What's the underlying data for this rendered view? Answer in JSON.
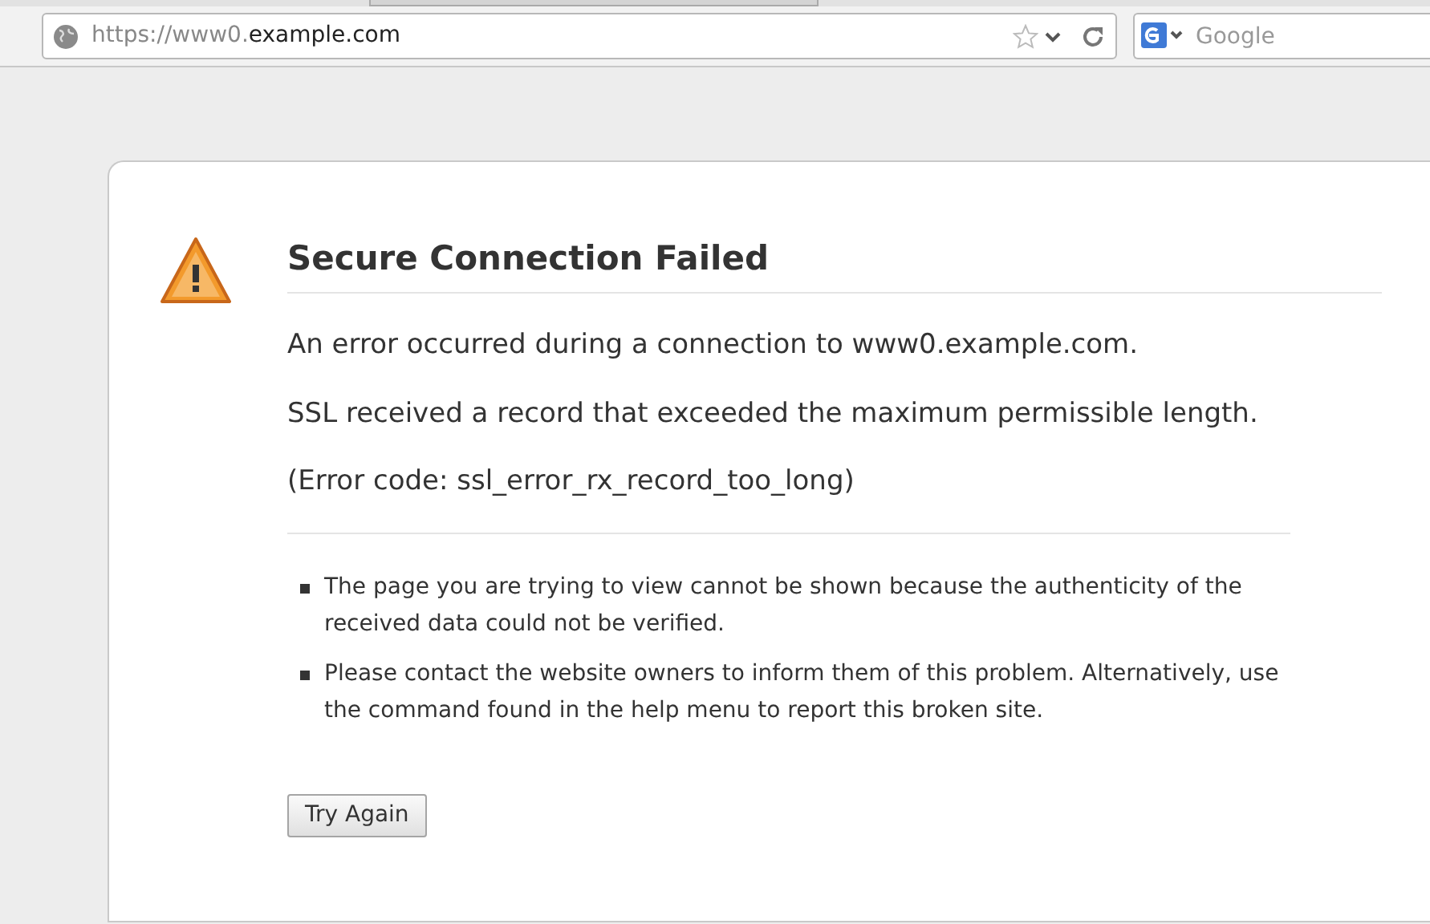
{
  "toolbar": {
    "url_prefix": "https://www0.",
    "url_domain": "example.com",
    "search": {
      "placeholder": "Google"
    }
  },
  "error": {
    "title": "Secure Connection Failed",
    "messages": [
      "An error occurred during a connection to www0.example.com.",
      "SSL received a record that exceeded the maximum permissible length.",
      "(Error code: ssl_error_rx_record_too_long)"
    ],
    "details": [
      "The page you are trying to view cannot be shown because the authenticity of the received data could not be verified.",
      "Please contact the website owners to inform them of this problem. Alternatively, use the command found in the help menu to report this broken site."
    ],
    "button": "Try Again"
  }
}
